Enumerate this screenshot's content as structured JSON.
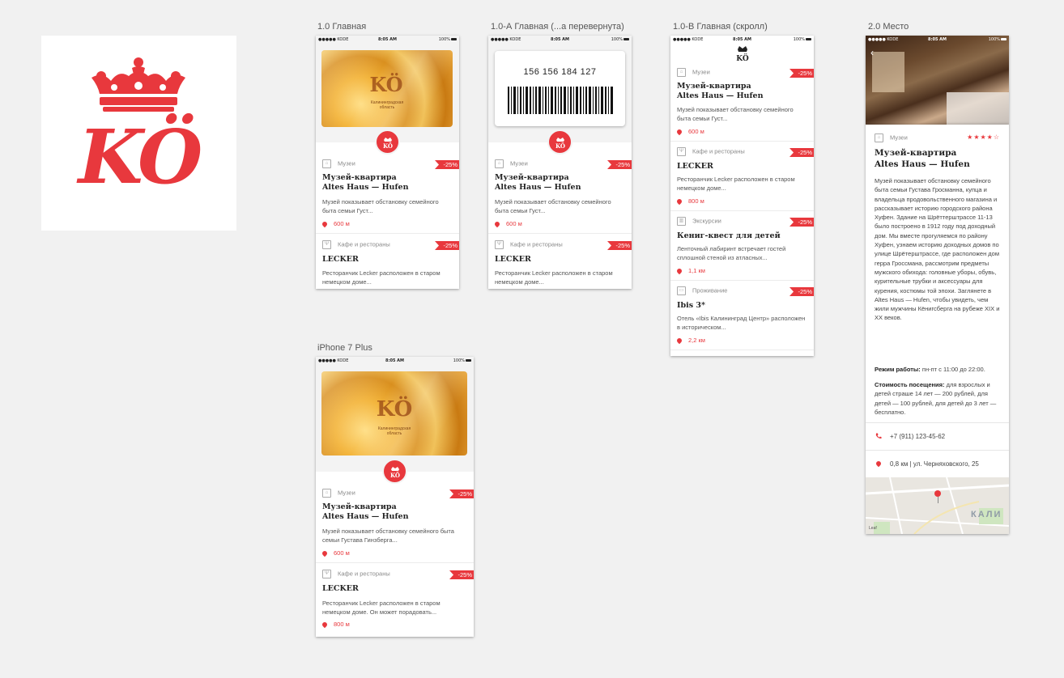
{
  "logo": {
    "letters": "KÖ",
    "color": "#e8383d"
  },
  "artboards": {
    "home": "1.0 Главная",
    "home_flipped": "1.0-А Главная (...а перевернута)",
    "home_scroll": "1.0-В Главная (скролл)",
    "place": "2.0 Место",
    "plus": "iPhone 7 Plus"
  },
  "status": {
    "carrier": "●●●●● KODE",
    "time": "8:05 AM",
    "battery": "100%"
  },
  "card": {
    "region": "Калининградская область",
    "barcode_number": "156 156 184 127",
    "mono": "KÖ"
  },
  "items": {
    "museum": {
      "category": "Музеи",
      "discount": "-25%",
      "title1": "Музей-квартира",
      "title2": "Altes Haus — Hufen",
      "desc": "Музей показывает обстановку семейного быта семьи Густ...",
      "desc_plus": "Музей показывает обстановку семейного быта семьи Густава Гинзберга...",
      "distance": "600 м"
    },
    "cafe": {
      "category": "Кафе и рестораны",
      "discount": "-25%",
      "title": "LECKER",
      "desc": "Ресторанчик Lecker расположен в старом немецком доме...",
      "desc_plus": "Ресторанчик Lecker расположен в старом немецком доме. Он может порадовать...",
      "distance": "800 м"
    },
    "tour": {
      "category": "Экскурсии",
      "discount": "-25%",
      "title": "Кениг-квест для детей",
      "desc": "Ленточный лабиринт встречает гостей сплошной стеной из атласных...",
      "distance": "1,1 км"
    },
    "hotel": {
      "category": "Проживание",
      "discount": "-25%",
      "title": "Ibis 3*",
      "desc": "Отель «Ibis Калининград Центр» расположен в историческом...",
      "distance": "2,2 км"
    }
  },
  "place": {
    "category": "Музеи",
    "rating": "★★★★☆",
    "title1": "Музей-квартира",
    "title2": "Altes Haus — Hufen",
    "description": "Музей показывает обстановку семейного быта семьи Густава Гросманна, купца и владельца продовольственного магазина и рассказывает историю городского района Хуфен. Здание на Шрёттерштрассе 11-13 было построено в 1912 году под доходный дом. Мы вместе прогуляемся по району Хуфен, узнаем историю доходных домов по улице Шрётерштрассе, где расположен дом герра Гроссмана, рассмотрим предметы мужского обихода: головные уборы, обувь, курительные трубки и аксессуары для курения, костюмы той эпохи. Заглянете в Altes Haus — Hufen, чтобы увидеть, чем жили мужчины Кёнигсберга на рубеже XIX и XX веков.",
    "hours_label": "Режим работы:",
    "hours_value": " пн-пт с 11:00 до 22:00.",
    "price_label": "Стоимость посещения:",
    "price_value": " для взрослых и детей страше 14 лет — 200 рублей, для детей — 100 рублей, для детей до 3 лет — бесплатно.",
    "phone": "+7 (911) 123-45-62",
    "address": "0,8 км | ул. Черняховского, 25",
    "map_city": "КАЛИ",
    "map_brand": "Leaf"
  },
  "colors": {
    "accent": "#e8383d",
    "background": "#f1f1f1"
  }
}
